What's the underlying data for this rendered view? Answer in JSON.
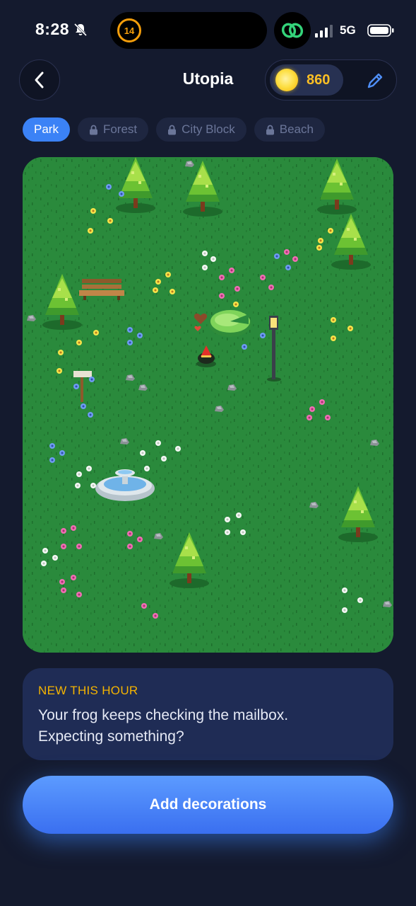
{
  "status_bar": {
    "time": "8:28",
    "island_badge": "14",
    "network": "5G"
  },
  "header": {
    "title": "Utopia",
    "coins": "860"
  },
  "tabs": [
    {
      "label": "Park",
      "locked": false,
      "active": true
    },
    {
      "label": "Forest",
      "locked": true,
      "active": false
    },
    {
      "label": "City Block",
      "locked": true,
      "active": false
    },
    {
      "label": "Beach",
      "locked": true,
      "active": false
    }
  ],
  "news": {
    "title": "NEW THIS HOUR",
    "text": "Your frog keeps checking the mailbox. Expecting something?"
  },
  "cta": {
    "label": "Add decorations"
  },
  "colors": {
    "background": "#141a2e",
    "accent": "#3b82f6",
    "coin": "#fbbf24",
    "grass": "#2a8a3c",
    "card": "#1f2c55"
  }
}
